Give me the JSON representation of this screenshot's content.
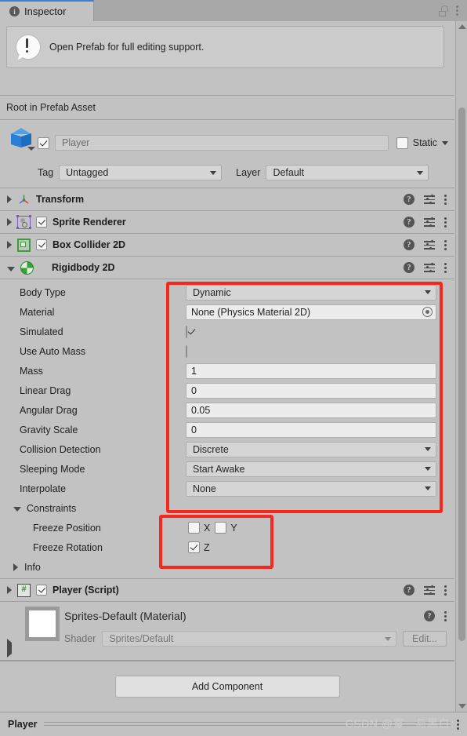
{
  "window": {
    "tab_label": "Inspector",
    "tab_icon": "info-icon",
    "lock_icon": "lock-open-icon",
    "menu_icon": "kebab-menu-icon"
  },
  "notice": {
    "icon": "alert-bubble-icon",
    "text": "Open Prefab for full editing support."
  },
  "prefab_root": {
    "label": "Root in Prefab Asset"
  },
  "gameobject": {
    "icon": "prefab-cube-icon",
    "enabled": true,
    "name": "Player",
    "static_label": "Static",
    "static_checked": false,
    "tag_label": "Tag",
    "tag_value": "Untagged",
    "layer_label": "Layer",
    "layer_value": "Default"
  },
  "components": [
    {
      "name": "Transform",
      "icon": "transform-icon",
      "expanded": false,
      "has_toggle": false
    },
    {
      "name": "Sprite Renderer",
      "icon": "sprite-renderer-icon",
      "expanded": false,
      "has_toggle": true,
      "enabled": true
    },
    {
      "name": "Box Collider 2D",
      "icon": "box-collider-2d-icon",
      "expanded": false,
      "has_toggle": true,
      "enabled": true
    },
    {
      "name": "Rigidbody 2D",
      "icon": "rigidbody-2d-icon",
      "expanded": true,
      "has_toggle": false
    }
  ],
  "rigidbody2d": {
    "properties": [
      {
        "label": "Body Type",
        "type": "dropdown",
        "value": "Dynamic"
      },
      {
        "label": "Material",
        "type": "object",
        "value": "None (Physics Material 2D)"
      },
      {
        "label": "Simulated",
        "type": "checkbox",
        "checked": true
      },
      {
        "label": "Use Auto Mass",
        "type": "checkbox",
        "checked": false
      },
      {
        "label": "Mass",
        "type": "text",
        "value": "1"
      },
      {
        "label": "Linear Drag",
        "type": "text",
        "value": "0"
      },
      {
        "label": "Angular Drag",
        "type": "text",
        "value": "0.05"
      },
      {
        "label": "Gravity Scale",
        "type": "text",
        "value": "0"
      },
      {
        "label": "Collision Detection",
        "type": "dropdown",
        "value": "Discrete"
      },
      {
        "label": "Sleeping Mode",
        "type": "dropdown",
        "value": "Start Awake"
      },
      {
        "label": "Interpolate",
        "type": "dropdown",
        "value": "None"
      }
    ],
    "constraints": {
      "label": "Constraints",
      "expanded": true,
      "freeze_position": {
        "label": "Freeze Position",
        "x_label": "X",
        "x_checked": false,
        "y_label": "Y",
        "y_checked": false
      },
      "freeze_rotation": {
        "label": "Freeze Rotation",
        "z_label": "Z",
        "z_checked": true
      }
    },
    "info": {
      "label": "Info",
      "expanded": false
    }
  },
  "script_component": {
    "name": "Player (Script)",
    "icon": "cs-script-icon",
    "enabled": true
  },
  "material": {
    "title": "Sprites-Default (Material)",
    "swatch_color": "#ffffff",
    "shader_label": "Shader",
    "shader_value": "Sprites/Default",
    "edit_label": "Edit..."
  },
  "add_component": {
    "label": "Add Component"
  },
  "footer": {
    "name": "Player",
    "watermark": "CSDN @零一与黑白",
    "menu_icon": "kebab-menu-icon"
  },
  "annotations": {
    "colors": {
      "highlight": "#f8261b",
      "accent": "#3e7fd4"
    },
    "boxes": [
      {
        "name": "rigidbody-properties-highlight"
      },
      {
        "name": "constraints-highlight"
      }
    ]
  }
}
